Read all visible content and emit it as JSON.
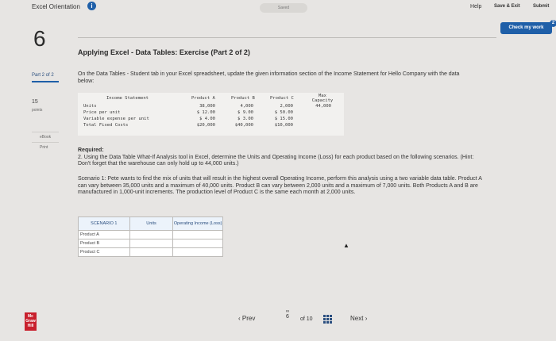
{
  "header": {
    "app_title": "Excel Orientation",
    "status": "Saved",
    "help": "Help",
    "save_exit": "Save & Exit",
    "submit": "Submit",
    "check_button": "Check my work",
    "check_badge": "2"
  },
  "sidebar": {
    "question_number": "6",
    "part": "Part 2 of 2",
    "points_value": "15",
    "points_label": "points",
    "ebook": "eBook",
    "print": "Print"
  },
  "question": {
    "title": "Applying Excel - Data Tables: Exercise (Part 2 of 2)",
    "intro": "On the Data Tables - Student tab in your Excel spreadsheet, update the given information section of the Income Statement for Hello Company with the data below:",
    "required_label": "Required:",
    "required_text": "2. Using the Data Table What-If Analysis tool in Excel, determine the Units and Operating Income (Loss) for each product based on the following scenarios. (Hint: Don't forget that the warehouse can only hold up to 44,000 units.)",
    "scenario_text": "Scenario 1: Pete wants to find the mix of units that will result in the highest overall Operating Income, perform this analysis using a two variable data table. Product A can vary between 35,000 units and a maximum of 40,000 units. Product B can vary between 2,000 units and a maximum of 7,000 units. Both Products A and B are manufactured in 1,000-unit increments. The production level of Product C is the same each month at 2,000 units."
  },
  "excel_data": {
    "heading": "Income Statement",
    "columns": [
      "Product A",
      "Product B",
      "Product C",
      "Max Capacity"
    ],
    "rows": [
      {
        "label": "Units",
        "values": [
          "38,000",
          "4,000",
          "2,000",
          "44,000"
        ]
      },
      {
        "label": "Price per unit",
        "values": [
          "$ 12.00",
          "$  9.00",
          "$ 50.00",
          ""
        ]
      },
      {
        "label": "Variable expense per unit",
        "values": [
          "$  4.00",
          "$  3.00",
          "$ 15.00",
          ""
        ]
      },
      {
        "label": "Total Fixed Costs",
        "values": [
          "$20,000",
          "$40,000",
          "$10,000",
          ""
        ]
      }
    ]
  },
  "answer_table": {
    "headers": [
      "SCENARIO 1",
      "Units",
      "Operating Income (Loss)"
    ],
    "rows": [
      "Product A",
      "Product B",
      "Product C"
    ]
  },
  "footer": {
    "prev": "Prev",
    "page_current": "6",
    "page_of": "of 10",
    "next": "Next",
    "logo_lines": [
      "Mc",
      "Graw",
      "Hill"
    ]
  }
}
